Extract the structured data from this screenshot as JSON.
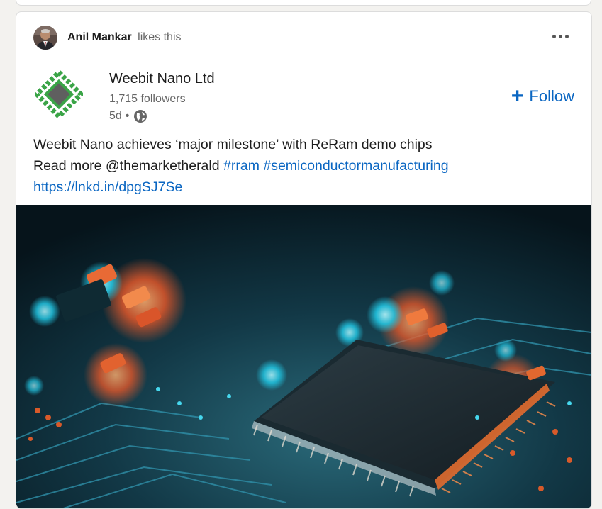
{
  "social": {
    "actor": "Anil Mankar",
    "action": "likes this"
  },
  "company": {
    "name": "Weebit Nano Ltd",
    "followers": "1,715 followers",
    "time": "5d",
    "separator": "•"
  },
  "follow": {
    "label": "Follow"
  },
  "post": {
    "line1": "Weebit Nano achieves ‘major milestone’ with ReRam demo chips",
    "line2_prefix": "Read more @themarketherald",
    "hashtag1": "#rram",
    "hashtag2": "#semiconductormanufacturing",
    "link": "https://lnkd.in/dpgSJ7Se"
  },
  "icons": {
    "more": "more-horizontal-icon",
    "globe": "globe-icon",
    "plus": "plus-icon"
  },
  "colors": {
    "accent": "#0a66c2",
    "logo_green": "#3aa447",
    "logo_gray": "#5f5f5f"
  }
}
